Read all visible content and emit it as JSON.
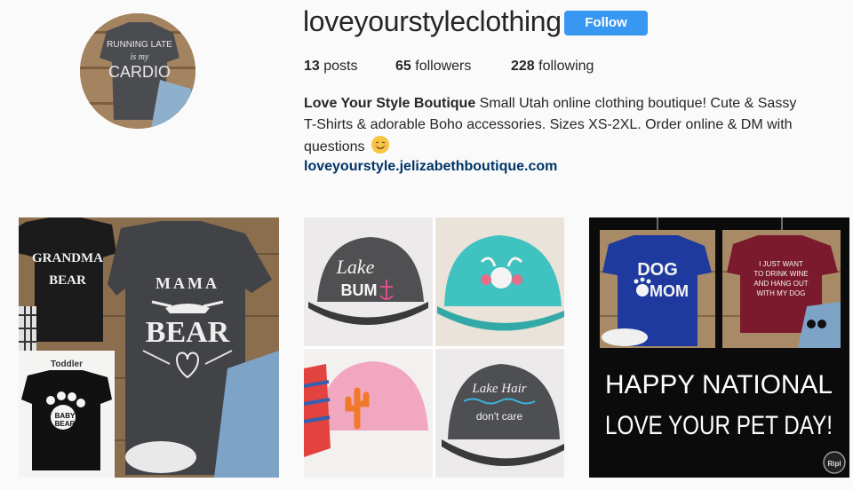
{
  "profile": {
    "username": "loveyourstyleclothing",
    "follow_label": "Follow",
    "avatar_shirt_text": [
      "RUNNING LATE",
      "is my",
      "CARDIO"
    ]
  },
  "stats": {
    "posts_count": "13",
    "posts_label": "posts",
    "followers_count": "65",
    "followers_label": "followers",
    "following_count": "228",
    "following_label": "following"
  },
  "bio": {
    "name": "Love Your Style Boutique",
    "text": "Small Utah online clothing boutique! Cute & Sassy T-Shirts & adorable Boho accessories. Sizes XS-2XL. Order online & DM with questions",
    "emoji": "smiling-face-emoji",
    "link": "loveyourstyle.jelizabethboutique.com"
  },
  "posts": [
    {
      "texts": [
        "GRANDMA",
        "BEAR",
        "MAMA",
        "BEAR",
        "Toddler",
        "BABY",
        "BEAR"
      ]
    },
    {
      "texts": [
        "Lake",
        "BUM",
        "Lake Hair",
        "don't care"
      ]
    },
    {
      "texts": [
        "DOG",
        "MOM",
        "I JUST WANT",
        "TO DRINK WINE",
        "AND HANG OUT",
        "WITH MY DOG",
        "HAPPY NATIONAL",
        "LOVE YOUR PET DAY!",
        "Ripl"
      ]
    }
  ],
  "colors": {
    "follow_button": "#3897f0",
    "link": "#003569",
    "text": "#262626",
    "background": "#fafafa"
  }
}
